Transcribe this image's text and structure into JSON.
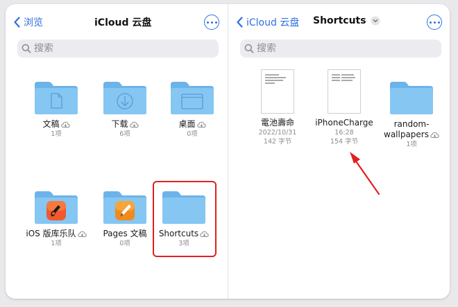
{
  "left_pane": {
    "back_label": "浏览",
    "title": "iCloud 云盘",
    "search_placeholder": "搜索",
    "items": [
      {
        "name": "文稿",
        "meta": "1项",
        "icon": "document-icon"
      },
      {
        "name": "下载",
        "meta": "6项",
        "icon": "download-icon"
      },
      {
        "name": "桌面",
        "meta": "0项",
        "icon": "desktop-icon"
      },
      {
        "name": "iOS 版库乐队",
        "meta": "1项",
        "icon": "garageband-icon"
      },
      {
        "name": "Pages 文稿",
        "meta": "0项",
        "icon": "pages-icon"
      },
      {
        "name": "Shortcuts",
        "meta": "3项",
        "icon": "folder-icon"
      }
    ]
  },
  "right_pane": {
    "back_label": "iCloud 云盘",
    "title": "Shortcuts",
    "search_placeholder": "搜索",
    "items": [
      {
        "name": "電池壽命",
        "date": "2022/10/31",
        "size": "142 字节"
      },
      {
        "name": "iPhoneCharge",
        "date": "16:28",
        "size": "154 字节"
      },
      {
        "name_line1": "random-",
        "name_line2": "wallpapers",
        "meta": "1项"
      }
    ]
  },
  "colors": {
    "accent": "#2f6fe0",
    "folder": "#7cc0f0",
    "highlight": "#e02020"
  }
}
